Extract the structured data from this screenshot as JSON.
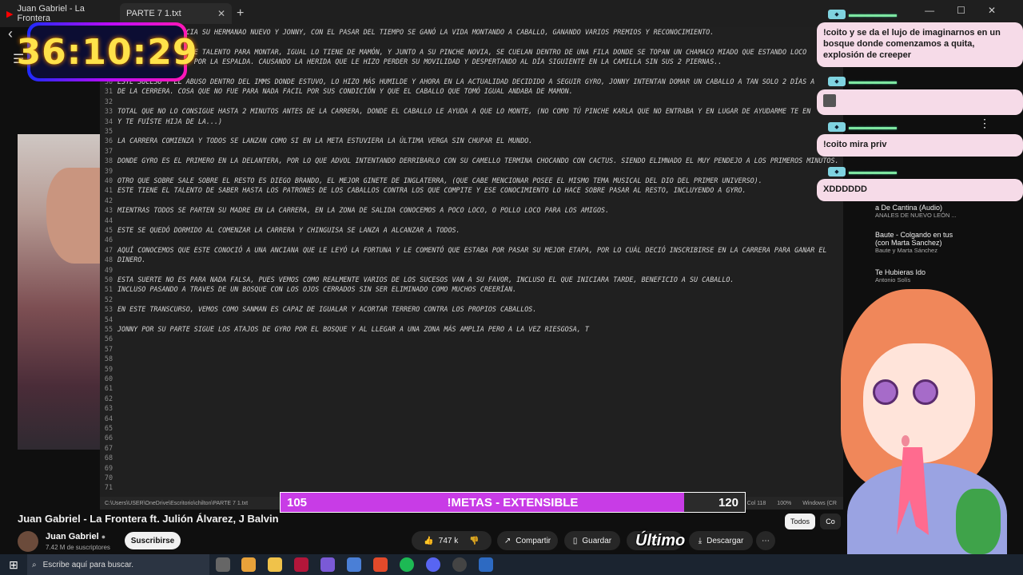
{
  "browser": {
    "tab_video_title": "Juan Gabriel - La Frontera",
    "tab_notepad_title": "PARTE 7 1.txt"
  },
  "timer": "36:10:29",
  "editor": {
    "lines": [
      {
        "n": "25",
        "t": "UN DÍA POR DESGRACIA SU HERMANAO NUEVO Y JONNY, CON EL PASAR DEL TIEMPO SE GANÓ LA VIDA MONTANDO A CABALLO, GANANDO VARIOS PREMIOS Y RECONOCIMIENTO."
      },
      {
        "n": "26",
        "t": ""
      },
      {
        "n": "27",
        "t": "PERO LO QUE TIENE DE TALENTO PARA MONTAR, IGUAL LO TIENE DE MAMÓN, Y JUNTO A SU PINCHE NOVIA, SE CUELAN DENTRO DE UNA FILA DONDE SE TOPAN UN CHAMACO MIADO QUE ESTANDO LOCO"
      },
      {
        "n": "28",
        "t": "LE DISPARA A JONNY POR LA ESPALDA. CAUSANDO LA HERIDA QUE LE HIZO PERDER SU MOVILIDAD Y DESPERTANDO AL DÍA SIGUIENTE EN LA CAMILLA SIN SUS 2 PIERNAS.."
      },
      {
        "n": "29",
        "t": ""
      },
      {
        "n": "30",
        "t": "ESTE SUCESO Y EL ABUSO DENTRO DEL IMMS DONDE ESTUVO, LO HIZO MÁS HUMILDE Y AHORA EN LA ACTUALIDAD DECIDIDO A SEGUIR GYRO, JONNY INTENTAN DOMAR UN CABALLO A TAN SOLO 2 DÍAS A"
      },
      {
        "n": "31",
        "t": "DE LA CERRERA. COSA QUE NO FUE PARA NADA FACIL POR SUS CONDICIÓN Y QUE EL CABALLO QUE TOMÓ IGUAL ANDABA DE MAMON."
      },
      {
        "n": "32",
        "t": ""
      },
      {
        "n": "33",
        "t": "TOTAL QUE NO LO CONSIGUE HASTA 2 MINUTOS ANTES DE LA CARRERA, DONDE EL CABALLO LE AYUDA A QUE LO MONTE, (NO COMO TÚ PINCHE KARLA QUE NO ENTRABA Y EN LUGAR DE AYUDARME TE EN"
      },
      {
        "n": "34",
        "t": "Y TE FUÍSTE HIJA DE LA...)"
      },
      {
        "n": "35",
        "t": ""
      },
      {
        "n": "36",
        "t": "LA CARRERA COMIENZA Y TODOS SE LANZAN COMO SI EN LA META ESTUVIERA LA ÚLTIMA VERGA SIN CHUPAR EL MUNDO."
      },
      {
        "n": "37",
        "t": ""
      },
      {
        "n": "38",
        "t": "DONDE GYRO ES EL PRIMERO EN LA DELANTERA, POR LO QUE ADVOL INTENTANDO DERRIBARLO CON SU CAMELLO TERMINA CHOCANDO CON CACTUS. SIENDO ELIMNADO EL MUY PENDEJO A LOS PRIMEROS MINUTOS."
      },
      {
        "n": "39",
        "t": ""
      },
      {
        "n": "40",
        "t": "OTRO QUE SOBRE SALE SOBRE EL RESTO ES DIEGO BRANDO, EL MEJOR GINETE DE INGLATERRA, (QUE CABE MENCIONAR POSEE EL MISMO TEMA MUSICAL DEL DIO DEL PRIMER UNIVERSO)."
      },
      {
        "n": "41",
        "t": "ESTE TIENE EL TALENTO DE SABER HASTA LOS PATRONES DE LOS CABALLOS CONTRA LOS QUE COMPITE Y ESE CONOCIMIENTO LO HACE SOBRE PASAR AL RESTO, INCLUYENDO A GYRO."
      },
      {
        "n": "42",
        "t": ""
      },
      {
        "n": "43",
        "t": "MIENTRAS TODOS SE PARTEN SU MADRE EN LA CARRERA, EN LA ZONA DE SALIDA CONOCEMOS A POCO LOCO, O POLLO LOCO PARA LOS AMIGOS."
      },
      {
        "n": "44",
        "t": ""
      },
      {
        "n": "45",
        "t": "ESTE SE QUEDÓ DORMIDO AL COMENZAR LA CARRERA Y CHINGUISA SE LANZA A ALCANZAR A TODOS."
      },
      {
        "n": "46",
        "t": ""
      },
      {
        "n": "47",
        "t": "AQUÍ CONOCEMOS QUE ESTE CONOCIÓ A UNA ANCIANA QUE LE LEYÓ LA FORTUNA Y LE COMENTÓ QUE ESTABA POR PASAR SU MEJOR ETAPA, POR LO CUÁL DECIÓ INSCRIBIRSE EN LA CARRERA PARA GANAR EL"
      },
      {
        "n": "48",
        "t": "DINERO."
      },
      {
        "n": "49",
        "t": ""
      },
      {
        "n": "50",
        "t": "ESTA SUERTE NO ES PARA NADA FALSA, PUES VEMOS COMO REALMENTE VARIOS DE LOS SUCESOS VAN A SU FAVOR, INCLUSO EL QUE INICIARA TARDE, BENEFICIO A SU CABALLO."
      },
      {
        "n": "51",
        "t": "INCLUSO PASANDO A TRAVES DE UN BOSQUE CON LOS OJOS CERRADOS SIN SER ELIMINADO COMO MUCHOS CREERÍAN."
      },
      {
        "n": "52",
        "t": ""
      },
      {
        "n": "53",
        "t": "EN ESTE TRANSCURSO, VEMOS COMO SANMAN ES CAPAZ DE IGUALAR Y ACORTAR TERRERO CONTRA LOS PROPIOS CABALLOS."
      },
      {
        "n": "54",
        "t": ""
      },
      {
        "n": "55",
        "t": "JONNY POR SU PARTE SIGUE LOS ATAJOS DE GYRO POR EL BOSQUE Y AL LLEGAR A UNA ZONA MÁS AMPLIA PERO A LA VEZ RIESGOSA, T"
      },
      {
        "n": "56",
        "t": ""
      },
      {
        "n": "57",
        "t": ""
      },
      {
        "n": "58",
        "t": ""
      },
      {
        "n": "59",
        "t": ""
      },
      {
        "n": "60",
        "t": ""
      },
      {
        "n": "61",
        "t": ""
      },
      {
        "n": "62",
        "t": ""
      },
      {
        "n": "63",
        "t": ""
      },
      {
        "n": "64",
        "t": ""
      },
      {
        "n": "65",
        "t": ""
      },
      {
        "n": "66",
        "t": ""
      },
      {
        "n": "67",
        "t": ""
      },
      {
        "n": "68",
        "t": ""
      },
      {
        "n": "69",
        "t": ""
      },
      {
        "n": "70",
        "t": ""
      },
      {
        "n": "71",
        "t": ""
      }
    ],
    "status_path": "C:\\Users\\USER\\OneDrive\\Escritorio\\chilton\\PARTE 7 1.txt",
    "status_position": "55, Col 118",
    "status_zoom": "100%",
    "status_eol": "Windows (CR"
  },
  "goal": {
    "start": "105",
    "label": "!METAS - EXTENSIBLE",
    "end": "120",
    "progress": 0.87
  },
  "video": {
    "title": "Juan Gabriel - La Frontera ft. Julión Álvarez, J Balvin",
    "channel": "Juan Gabriel",
    "subscribers": "7.42 M de suscriptores",
    "subscribe_label": "Suscribirse",
    "likes": "747 k",
    "share_label": "Compartir",
    "save_label": "Guardar",
    "download_label": "Descargar",
    "overlay_text": "Último"
  },
  "recs": [
    {
      "title": "a De Cantina (Audio)",
      "sub": "ANALES DE NUEVO LEÓN ..."
    },
    {
      "title": "Baute - Colgando en tus",
      "title2": "(con Marta Sanchez)",
      "sub": "Baute y Marta Sánchez"
    },
    {
      "title": "Te Hubieras Ido",
      "sub": "Antonio Solís"
    }
  ],
  "chips": {
    "todos": "Todos",
    "con": "Co"
  },
  "chat": [
    {
      "text": "!coito y se da el lujo de imaginarnos en un bosque donde comenzamos a quita, explosión de creeper"
    },
    {
      "text": ""
    },
    {
      "text": "!coito mira priv"
    },
    {
      "text": "XDDDDDD"
    }
  ],
  "taskbar": {
    "search_placeholder": "Escribe aquí para buscar."
  },
  "colors": {
    "goal_fill": "#c83ce6",
    "editor_bg": "#202020",
    "chat_bg": "#f6dbe8"
  }
}
